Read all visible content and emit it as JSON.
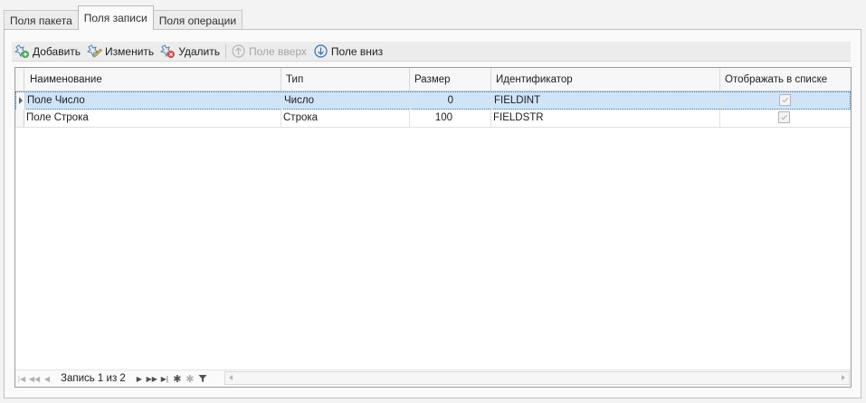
{
  "tabs": [
    {
      "label": "Поля пакета"
    },
    {
      "label": "Поля записи",
      "active": true
    },
    {
      "label": "Поля операции"
    }
  ],
  "toolbar": {
    "add": {
      "label": "Добавить",
      "icon": "add-field-icon"
    },
    "edit": {
      "label": "Изменить",
      "icon": "edit-field-icon"
    },
    "delete": {
      "label": "Удалить",
      "icon": "delete-field-icon"
    },
    "up": {
      "label": "Поле вверх",
      "icon": "arrow-up-circle-icon",
      "disabled": true
    },
    "down": {
      "label": "Поле вниз",
      "icon": "arrow-down-circle-icon"
    }
  },
  "grid": {
    "columns": [
      "Наименование",
      "Тип",
      "Размер",
      "Идентификатор",
      "Отображать в списке"
    ],
    "rows": [
      {
        "name": "Поле Число",
        "type": "Число",
        "size": "0",
        "id": "FIELDINT",
        "show": true,
        "selected": true
      },
      {
        "name": "Поле Строка",
        "type": "Строка",
        "size": "100",
        "id": "FIELDSTR",
        "show": true
      }
    ]
  },
  "navigator": {
    "record_text": "Запись 1 из 2"
  },
  "colors": {
    "accent": "#3a78c4",
    "selection": "#cfe4f7"
  }
}
